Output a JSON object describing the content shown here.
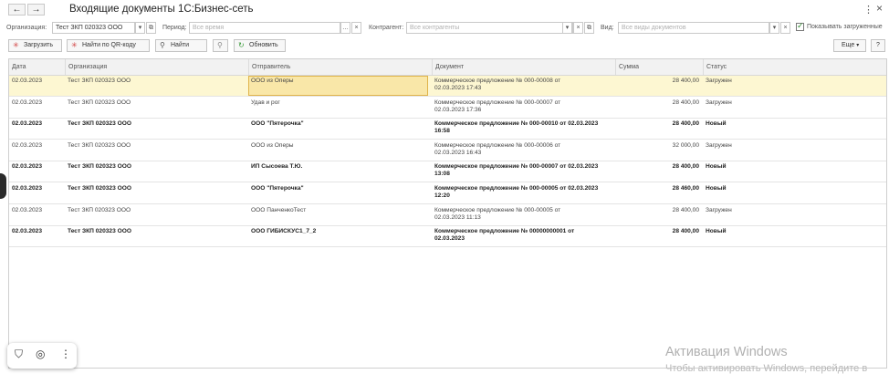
{
  "window": {
    "title": "Входящие документы 1С:Бизнес-сеть",
    "back_icon": "←",
    "forward_icon": "→",
    "more_icon": "⋮",
    "close_icon": "×"
  },
  "filters": {
    "organization_label": "Организация:",
    "organization_value": "Тест ЗКП 020323 ООО",
    "period_label": "Период:",
    "period_placeholder": "Все время",
    "counterparty_label": "Контрагент:",
    "counterparty_placeholder": "Все контрагенты",
    "kind_label": "Вид:",
    "kind_placeholder": "Все виды документов",
    "show_loaded_label": "Показывать загруженные",
    "show_loaded_checked": true
  },
  "toolbar": {
    "load": "Загрузить",
    "find_qr": "Найти по QR-коду",
    "find": "Найти",
    "refresh": "Обновить",
    "more": "Еще",
    "help": "?"
  },
  "table": {
    "columns": [
      "Дата",
      "Организация",
      "Отправитель",
      "Документ",
      "Сумма",
      "Статус"
    ],
    "rows": [
      {
        "date": "02.03.2023",
        "org": "Тест ЗКП 020323 ООО",
        "sender": "ООО из Оперы",
        "doc1": "Коммерческое предложение № 000-00008 от",
        "doc2": "02.03.2023 17:43",
        "sum": "28 400,00",
        "status": "Загружен",
        "bold": false,
        "selected": true
      },
      {
        "date": "02.03.2023",
        "org": "Тест ЗКП 020323 ООО",
        "sender": "Удав и рог",
        "doc1": "Коммерческое предложение № 000-00007 от",
        "doc2": "02.03.2023 17:36",
        "sum": "28 400,00",
        "status": "Загружен",
        "bold": false,
        "selected": false
      },
      {
        "date": "02.03.2023",
        "org": "Тест ЗКП 020323 ООО",
        "sender": "ООО \"Пятерочка\"",
        "doc1": "Коммерческое предложение № 000-00010 от 02.03.2023",
        "doc2": "16:58",
        "sum": "28 400,00",
        "status": "Новый",
        "bold": true,
        "selected": false
      },
      {
        "date": "02.03.2023",
        "org": "Тест ЗКП 020323 ООО",
        "sender": "ООО из Оперы",
        "doc1": "Коммерческое предложение № 000-00006 от",
        "doc2": "02.03.2023 16:43",
        "sum": "32 000,00",
        "status": "Загружен",
        "bold": false,
        "selected": false
      },
      {
        "date": "02.03.2023",
        "org": "Тест ЗКП 020323 ООО",
        "sender": "ИП Сысоева Т.Ю.",
        "doc1": "Коммерческое предложение № 000-00007 от 02.03.2023",
        "doc2": "13:08",
        "sum": "28 400,00",
        "status": "Новый",
        "bold": true,
        "selected": false
      },
      {
        "date": "02.03.2023",
        "org": "Тест ЗКП 020323 ООО",
        "sender": "ООО \"Пятерочка\"",
        "doc1": "Коммерческое предложение № 000-00005 от 02.03.2023",
        "doc2": "12:20",
        "sum": "28 460,00",
        "status": "Новый",
        "bold": true,
        "selected": false
      },
      {
        "date": "02.03.2023",
        "org": "Тест ЗКП 020323 ООО",
        "sender": "ООО ПанченкоТест",
        "doc1": "Коммерческое предложение № 000-00005 от",
        "doc2": "02.03.2023 11:13",
        "sum": "28 400,00",
        "status": "Загружен",
        "bold": false,
        "selected": false
      },
      {
        "date": "02.03.2023",
        "org": "Тест ЗКП 020323 ООО",
        "sender": "ООО ГИБИСКУС1_7_2",
        "doc1": "Коммерческое предложение № 00000000001 от",
        "doc2": "02.03.2023",
        "sum": "28 400,00",
        "status": "Новый",
        "bold": true,
        "selected": false
      }
    ]
  },
  "watermark": {
    "line1": "Активация Windows",
    "line2": "Чтобы активировать Windows, перейдите в"
  },
  "colors": {
    "selected_row": "#fdf7d2",
    "focused_cell": "#f9e7a8",
    "refresh_icon": "#3a9a3a",
    "load_icon": "#d04040"
  }
}
